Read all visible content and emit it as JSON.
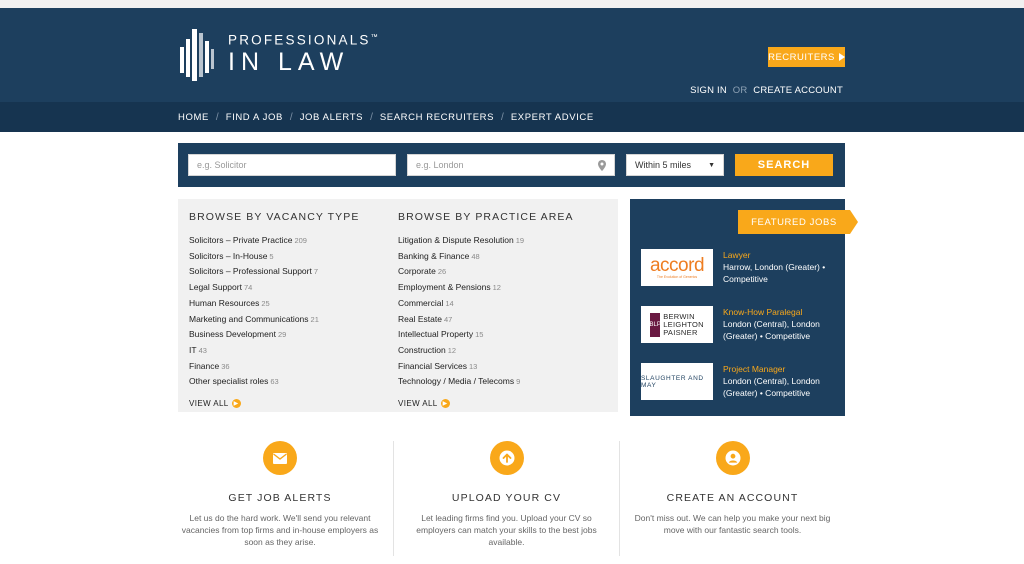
{
  "brand": {
    "line1": "PROFESSIONALS",
    "tm": "™",
    "line2": "IN LAW"
  },
  "header": {
    "recruiters": "RECRUITERS",
    "sign_in": "SIGN IN",
    "or": "OR",
    "create_account": "CREATE ACCOUNT"
  },
  "nav": [
    "HOME",
    "FIND A JOB",
    "JOB ALERTS",
    "SEARCH RECRUITERS",
    "EXPERT ADVICE"
  ],
  "search": {
    "keyword_placeholder": "e.g. Solicitor",
    "location_placeholder": "e.g. London",
    "radius": "Within 5 miles",
    "button": "SEARCH"
  },
  "browse": {
    "vacancy": {
      "heading": "BROWSE BY VACANCY TYPE",
      "items": [
        {
          "label": "Solicitors – Private Practice",
          "count": "209"
        },
        {
          "label": "Solicitors – In-House",
          "count": "5"
        },
        {
          "label": "Solicitors – Professional Support",
          "count": "7"
        },
        {
          "label": "Legal Support",
          "count": "74"
        },
        {
          "label": "Human Resources",
          "count": "25"
        },
        {
          "label": "Marketing and Communications",
          "count": "21"
        },
        {
          "label": "Business Development",
          "count": "29"
        },
        {
          "label": "IT",
          "count": "43"
        },
        {
          "label": "Finance",
          "count": "36"
        },
        {
          "label": "Other specialist roles",
          "count": "63"
        }
      ],
      "view_all": "VIEW ALL"
    },
    "practice": {
      "heading": "BROWSE BY PRACTICE AREA",
      "items": [
        {
          "label": "Litigation & Dispute Resolution",
          "count": "19"
        },
        {
          "label": "Banking & Finance",
          "count": "48"
        },
        {
          "label": "Corporate",
          "count": "26"
        },
        {
          "label": "Employment & Pensions",
          "count": "12"
        },
        {
          "label": "Commercial",
          "count": "14"
        },
        {
          "label": "Real Estate",
          "count": "47"
        },
        {
          "label": "Intellectual Property",
          "count": "15"
        },
        {
          "label": "Construction",
          "count": "12"
        },
        {
          "label": "Financial Services",
          "count": "13"
        },
        {
          "label": "Technology / Media / Telecoms",
          "count": "9"
        }
      ],
      "view_all": "VIEW ALL"
    }
  },
  "featured": {
    "heading": "FEATURED JOBS",
    "jobs": [
      {
        "title": "Lawyer",
        "location": "Harrow, London (Greater) • Competitive",
        "logo_word": "accord",
        "logo_tag": "The Evolution of Generics"
      },
      {
        "title": "Know-How Paralegal",
        "location": "London (Central), London (Greater) • Competitive",
        "logo_mark": "BLP",
        "logo_lines": [
          "BERWIN",
          "LEIGHTON",
          "PAISNER"
        ]
      },
      {
        "title": "Project Manager",
        "location": "London (Central), London (Greater) • Competitive",
        "logo_text": "SLAUGHTER AND MAY"
      }
    ]
  },
  "features": [
    {
      "icon": "envelope-icon",
      "title": "GET JOB ALERTS",
      "text": "Let us do the hard work. We'll send you relevant vacancies from top firms and in-house employers as soon as they arise."
    },
    {
      "icon": "upload-arrow-icon",
      "title": "UPLOAD YOUR CV",
      "text": "Let leading firms find you. Upload your CV so employers can match your skills to the best jobs available."
    },
    {
      "icon": "user-icon",
      "title": "CREATE AN ACCOUNT",
      "text": "Don't miss out. We can help you make your next big move with our fantastic search tools."
    }
  ],
  "colors": {
    "navy": "#1d3f5e",
    "navy_dark": "#163450",
    "accent": "#f9a81a"
  }
}
